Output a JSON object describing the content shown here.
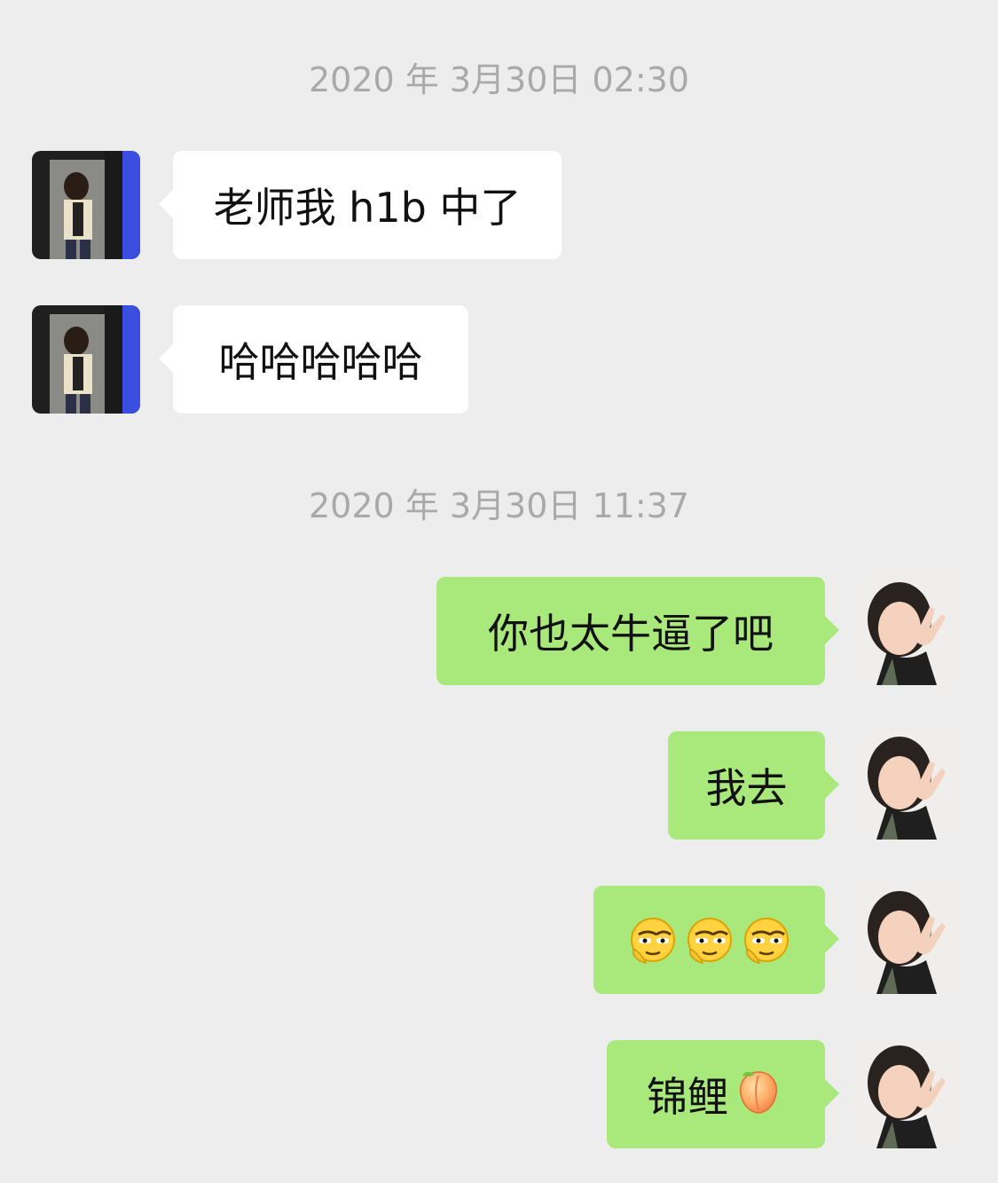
{
  "chat": {
    "timestamps": [
      "2020 年 3月30日 02:30",
      "2020 年 3月30日 11:37"
    ],
    "messages": [
      {
        "side": "left",
        "text": "老师我 h1b 中了"
      },
      {
        "side": "left",
        "text": "哈哈哈哈哈"
      },
      {
        "side": "right",
        "text": "你也太牛逼了吧"
      },
      {
        "side": "right",
        "text": "我去"
      },
      {
        "side": "right",
        "text": "",
        "emoji": [
          "smirk-thinking-emoji",
          "smirk-thinking-emoji",
          "smirk-thinking-emoji"
        ]
      },
      {
        "side": "right",
        "text": "锦鲤",
        "emoji": [
          "peach-emoji"
        ]
      }
    ]
  },
  "colors": {
    "background": "#ededed",
    "left_bubble": "#ffffff",
    "right_bubble": "#a9e97b",
    "timestamp_text": "#a9a9a9"
  },
  "icons": {
    "left_avatar": "avatar-photo",
    "right_avatar": "avatar-photo"
  }
}
